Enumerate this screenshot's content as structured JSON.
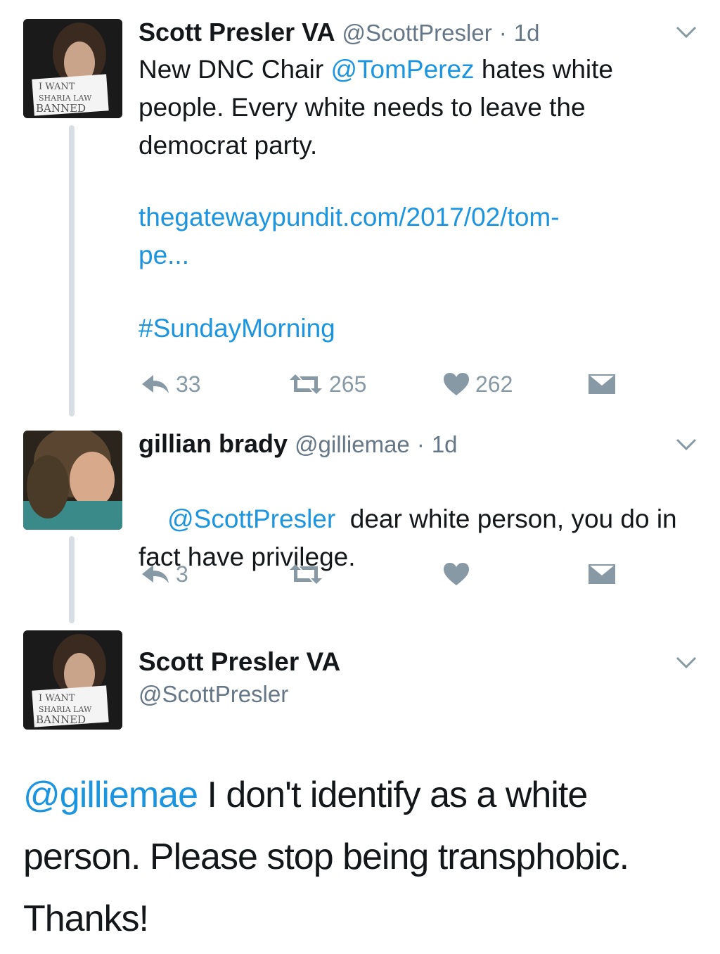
{
  "tweets": [
    {
      "name": "Scott Presler VA",
      "handle": "@ScottPresler",
      "dot": "·",
      "time": "1d",
      "text_mention": "New DNC Chair ",
      "mention": "@TomPerez",
      "text_after_mention": " hates white people. Every white needs to leave the democrat party.",
      "link_line1": "thegatewaypundit.com/2017/02/tom-",
      "link_line2": "pe...",
      "hashtag": "#SundayMorning",
      "replies": "33",
      "retweets": "265",
      "likes": "262",
      "avatar_sign": [
        "I WANT",
        "SHARIA LAW",
        "BANNED"
      ]
    },
    {
      "name": "gillian brady",
      "handle": "@gilliemae",
      "dot": "·",
      "time": "1d",
      "mention": "@ScottPresler",
      "text_after_mention": "  dear white person, you do in fact have privilege.",
      "replies": "3"
    }
  ],
  "expanded": {
    "name": "Scott Presler VA",
    "handle": "@ScottPresler",
    "mention": "@gilliemae",
    "text": " I don't identify as a white person. Please stop being transphobic. Thanks!",
    "avatar_sign": [
      "I WANT",
      "SHARIA LAW",
      "BANNED"
    ]
  },
  "colors": {
    "link": "#1b95e0",
    "muted": "#657786",
    "icon": "#8899a6",
    "thread_line": "#d8dee3"
  },
  "icons": [
    "reply-icon",
    "retweet-icon",
    "like-icon",
    "direct-message-icon",
    "chevron-down-icon"
  ]
}
